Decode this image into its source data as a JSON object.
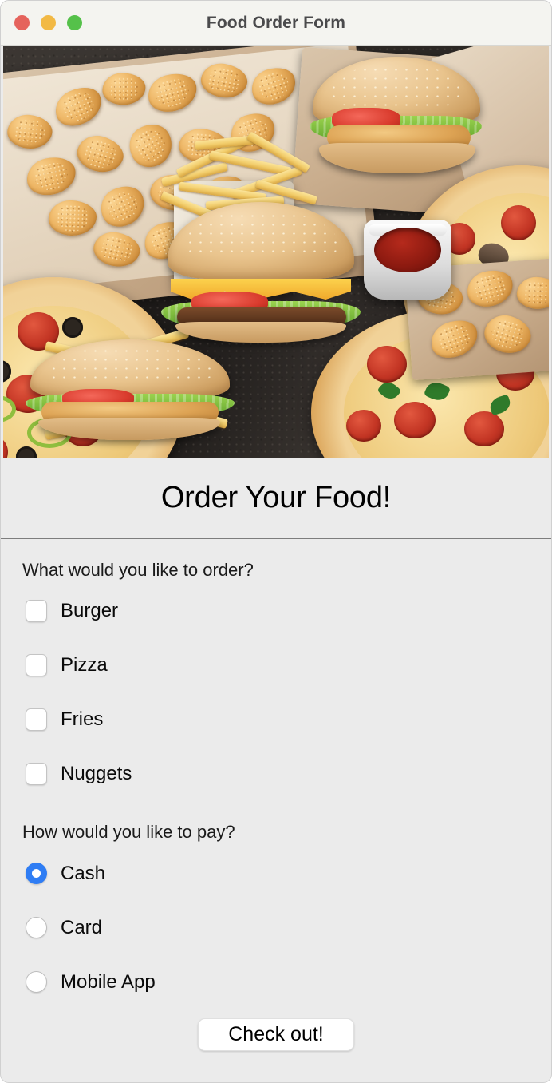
{
  "window": {
    "title": "Food Order Form",
    "background_color": "#ebebeb",
    "titlebar_color": "#f4f4f0",
    "traffic_lights": [
      {
        "name": "close",
        "color": "#e5635c"
      },
      {
        "name": "minimize",
        "color": "#f2b944"
      },
      {
        "name": "zoom",
        "color": "#55c14a"
      }
    ]
  },
  "hero": {
    "alt": "Assorted fast food: pizzas, burgers, fries, chicken nuggets and ketchup"
  },
  "heading": "Order Your Food!",
  "form": {
    "order_question": "What would you like to order?",
    "order_options": [
      {
        "label": "Burger",
        "checked": false
      },
      {
        "label": "Pizza",
        "checked": false
      },
      {
        "label": "Fries",
        "checked": false
      },
      {
        "label": "Nuggets",
        "checked": false
      }
    ],
    "payment_question": "How would you like to pay?",
    "payment_options": [
      {
        "label": "Cash",
        "selected": true
      },
      {
        "label": "Card",
        "selected": false
      },
      {
        "label": "Mobile App",
        "selected": false
      }
    ],
    "selected_payment": "Cash",
    "accent_color": "#2f7df4",
    "submit_label": "Check out!"
  }
}
